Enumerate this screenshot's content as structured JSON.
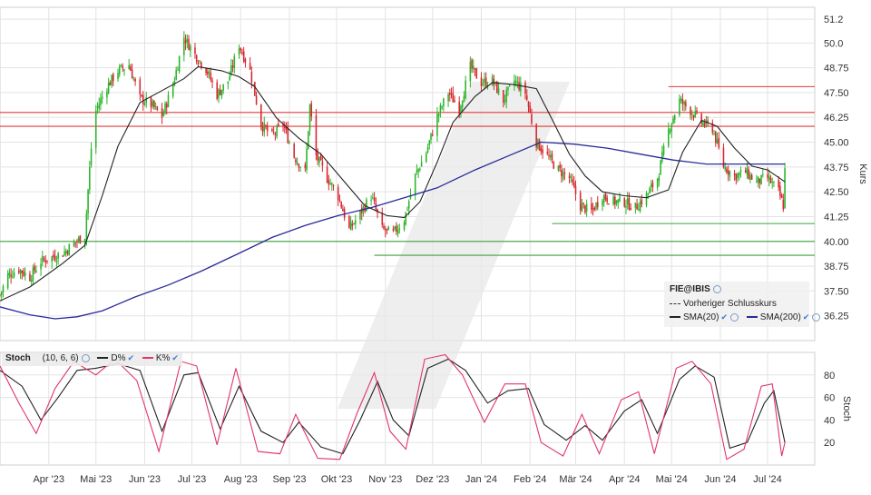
{
  "chart_data": [
    {
      "type": "candlestick",
      "symbol": "FIE@IBIS",
      "ylabel": "Kurs",
      "ylim": [
        35.0,
        51.8
      ],
      "y_ticks": [
        "51.2",
        "50.0",
        "48.75",
        "47.50",
        "46.25",
        "45.00",
        "43.75",
        "42.50",
        "41.25",
        "40.00",
        "38.75",
        "37.50",
        "36.25"
      ],
      "x_ticks": [
        "Apr '23",
        "Mai '23",
        "Jun '23",
        "Jul '23",
        "Aug '23",
        "Sep '23",
        "Okt '23",
        "Nov '23",
        "Dez '23",
        "Jan '24",
        "Feb '24",
        "Mär '24",
        "Apr '24",
        "Mai '24",
        "Jun '24",
        "Jul '24"
      ],
      "x_tick_dates": [
        "2023-04-01",
        "2023-05-01",
        "2023-06-01",
        "2023-07-01",
        "2023-08-01",
        "2023-09-01",
        "2023-10-01",
        "2023-11-01",
        "2023-12-01",
        "2024-01-01",
        "2024-02-01",
        "2024-03-01",
        "2024-04-01",
        "2024-05-01",
        "2024-06-01",
        "2024-07-01"
      ],
      "price_path": [
        [
          "2023-03-01",
          37.3
        ],
        [
          "2023-03-06",
          38.3
        ],
        [
          "2023-03-13",
          38.6
        ],
        [
          "2023-03-20",
          38.2
        ],
        [
          "2023-03-27",
          39.0
        ],
        [
          "2023-04-03",
          39.2
        ],
        [
          "2023-04-10",
          39.4
        ],
        [
          "2023-04-17",
          39.9
        ],
        [
          "2023-04-24",
          40.3
        ],
        [
          "2023-04-26",
          42.6
        ],
        [
          "2023-04-28",
          44.7
        ],
        [
          "2023-05-01",
          46.6
        ],
        [
          "2023-05-08",
          47.8
        ],
        [
          "2023-05-15",
          48.6
        ],
        [
          "2023-05-22",
          48.9
        ],
        [
          "2023-05-29",
          47.2
        ],
        [
          "2023-06-05",
          46.9
        ],
        [
          "2023-06-12",
          46.3
        ],
        [
          "2023-06-19",
          47.9
        ],
        [
          "2023-06-26",
          50.3
        ],
        [
          "2023-07-03",
          49.4
        ],
        [
          "2023-07-10",
          48.7
        ],
        [
          "2023-07-17",
          47.4
        ],
        [
          "2023-07-24",
          48.1
        ],
        [
          "2023-07-31",
          49.9
        ],
        [
          "2023-08-07",
          48.6
        ],
        [
          "2023-08-14",
          45.9
        ],
        [
          "2023-08-21",
          45.3
        ],
        [
          "2023-08-28",
          45.9
        ],
        [
          "2023-09-04",
          44.3
        ],
        [
          "2023-09-11",
          43.5
        ],
        [
          "2023-09-14",
          46.8
        ],
        [
          "2023-09-18",
          44.3
        ],
        [
          "2023-09-25",
          43.2
        ],
        [
          "2023-10-02",
          42.3
        ],
        [
          "2023-10-09",
          40.6
        ],
        [
          "2023-10-16",
          41.4
        ],
        [
          "2023-10-23",
          42.3
        ],
        [
          "2023-10-30",
          40.6
        ],
        [
          "2023-11-06",
          40.4
        ],
        [
          "2023-11-13",
          41.1
        ],
        [
          "2023-11-20",
          43.3
        ],
        [
          "2023-11-27",
          44.5
        ],
        [
          "2023-12-04",
          46.3
        ],
        [
          "2023-12-11",
          47.5
        ],
        [
          "2023-12-18",
          46.7
        ],
        [
          "2023-12-25",
          48.8
        ],
        [
          "2024-01-01",
          48.0
        ],
        [
          "2024-01-08",
          48.1
        ],
        [
          "2024-01-15",
          47.1
        ],
        [
          "2024-01-22",
          48.1
        ],
        [
          "2024-01-29",
          47.5
        ],
        [
          "2024-02-05",
          45.0
        ],
        [
          "2024-02-12",
          44.3
        ],
        [
          "2024-02-19",
          43.6
        ],
        [
          "2024-02-26",
          43.2
        ],
        [
          "2024-03-04",
          41.8
        ],
        [
          "2024-03-11",
          41.5
        ],
        [
          "2024-03-18",
          42.3
        ],
        [
          "2024-03-25",
          42.0
        ],
        [
          "2024-04-01",
          42.0
        ],
        [
          "2024-04-08",
          41.7
        ],
        [
          "2024-04-15",
          42.3
        ],
        [
          "2024-04-22",
          43.2
        ],
        [
          "2024-04-29",
          45.6
        ],
        [
          "2024-05-06",
          47.1
        ],
        [
          "2024-05-13",
          46.6
        ],
        [
          "2024-05-20",
          46.0
        ],
        [
          "2024-05-27",
          45.7
        ],
        [
          "2024-06-03",
          43.8
        ],
        [
          "2024-06-10",
          43.3
        ],
        [
          "2024-06-17",
          43.5
        ],
        [
          "2024-06-24",
          43.0
        ],
        [
          "2024-07-01",
          43.2
        ],
        [
          "2024-07-08",
          42.5
        ],
        [
          "2024-07-11",
          41.8
        ],
        [
          "2024-07-12",
          43.6
        ]
      ],
      "sma20": [
        [
          "2023-03-01",
          37.0
        ],
        [
          "2023-03-20",
          37.7
        ],
        [
          "2023-04-10",
          38.9
        ],
        [
          "2023-04-24",
          39.8
        ],
        [
          "2023-05-05",
          42.3
        ],
        [
          "2023-05-15",
          44.8
        ],
        [
          "2023-05-29",
          47.0
        ],
        [
          "2023-06-12",
          47.6
        ],
        [
          "2023-06-26",
          48.2
        ],
        [
          "2023-07-05",
          48.8
        ],
        [
          "2023-07-20",
          48.6
        ],
        [
          "2023-07-31",
          48.3
        ],
        [
          "2023-08-10",
          47.8
        ],
        [
          "2023-08-24",
          46.2
        ],
        [
          "2023-09-07",
          45.2
        ],
        [
          "2023-09-21",
          44.4
        ],
        [
          "2023-10-05",
          43.1
        ],
        [
          "2023-10-19",
          41.8
        ],
        [
          "2023-11-02",
          41.3
        ],
        [
          "2023-11-13",
          41.2
        ],
        [
          "2023-11-23",
          42.0
        ],
        [
          "2023-12-04",
          44.0
        ],
        [
          "2023-12-14",
          46.0
        ],
        [
          "2023-12-28",
          47.3
        ],
        [
          "2024-01-08",
          48.0
        ],
        [
          "2024-01-22",
          47.9
        ],
        [
          "2024-02-05",
          47.7
        ],
        [
          "2024-02-16",
          46.0
        ],
        [
          "2024-02-26",
          44.4
        ],
        [
          "2024-03-07",
          43.3
        ],
        [
          "2024-03-18",
          42.5
        ],
        [
          "2024-04-01",
          42.3
        ],
        [
          "2024-04-15",
          42.2
        ],
        [
          "2024-04-29",
          42.6
        ],
        [
          "2024-05-08",
          44.5
        ],
        [
          "2024-05-20",
          46.1
        ],
        [
          "2024-05-30",
          45.8
        ],
        [
          "2024-06-10",
          44.7
        ],
        [
          "2024-06-21",
          43.8
        ],
        [
          "2024-07-01",
          43.6
        ],
        [
          "2024-07-12",
          43.0
        ]
      ],
      "sma200": [
        [
          "2023-03-01",
          36.7
        ],
        [
          "2023-03-20",
          36.3
        ],
        [
          "2023-04-05",
          36.1
        ],
        [
          "2023-04-19",
          36.2
        ],
        [
          "2023-05-05",
          36.5
        ],
        [
          "2023-05-26",
          37.2
        ],
        [
          "2023-06-16",
          37.8
        ],
        [
          "2023-07-07",
          38.5
        ],
        [
          "2023-07-31",
          39.4
        ],
        [
          "2023-08-21",
          40.2
        ],
        [
          "2023-09-11",
          40.8
        ],
        [
          "2023-10-02",
          41.3
        ],
        [
          "2023-10-23",
          41.7
        ],
        [
          "2023-11-13",
          42.2
        ],
        [
          "2023-12-04",
          42.7
        ],
        [
          "2023-12-28",
          43.6
        ],
        [
          "2024-01-18",
          44.3
        ],
        [
          "2024-02-08",
          45.0
        ],
        [
          "2024-02-29",
          44.9
        ],
        [
          "2024-03-21",
          44.7
        ],
        [
          "2024-04-11",
          44.4
        ],
        [
          "2024-05-02",
          44.1
        ],
        [
          "2024-05-23",
          43.9
        ],
        [
          "2024-06-13",
          43.9
        ],
        [
          "2024-07-12",
          43.9
        ]
      ],
      "horizontal_lines": [
        {
          "kind": "resistance",
          "value": 47.8,
          "from": "2024-04-29",
          "to": "2024-07-31",
          "color": "#e03c3c"
        },
        {
          "kind": "resistance",
          "value": 46.5,
          "from": "2023-03-01",
          "to": "2024-07-31",
          "color": "#e03c3c"
        },
        {
          "kind": "resistance",
          "value": 45.8,
          "from": "2023-03-01",
          "to": "2024-07-31",
          "color": "#e03c3c"
        },
        {
          "kind": "support",
          "value": 40.9,
          "from": "2024-02-15",
          "to": "2024-07-31",
          "color": "#3aa33a"
        },
        {
          "kind": "support",
          "value": 40.0,
          "from": "2023-03-01",
          "to": "2024-07-31",
          "color": "#3aa33a"
        },
        {
          "kind": "support",
          "value": 39.3,
          "from": "2023-10-25",
          "to": "2024-07-31",
          "color": "#3aa33a"
        }
      ],
      "colors": {
        "up": "#2ab52a",
        "down": "#d8262e",
        "sma20": "#222222",
        "sma200": "#2a2a9a",
        "grid": "#e3e3e3"
      },
      "legend": {
        "title": "FIE@IBIS",
        "entries": [
          "Vorheriger Schlusskurs",
          "SMA(20)",
          "SMA(200)"
        ]
      },
      "grid": true,
      "legend_placement": "bottom-right"
    },
    {
      "type": "line",
      "name": "Stoch",
      "params": "(10, 6, 6)",
      "ylabel": "Stoch",
      "ylim": [
        0,
        100
      ],
      "y_ticks": [
        "80",
        "60",
        "40",
        "20"
      ],
      "series": [
        {
          "name": "D%",
          "color": "#222222",
          "points": [
            [
              "2023-03-01",
              84
            ],
            [
              "2023-03-15",
              70
            ],
            [
              "2023-03-27",
              40
            ],
            [
              "2023-04-07",
              60
            ],
            [
              "2023-04-19",
              84
            ],
            [
              "2023-05-01",
              86
            ],
            [
              "2023-05-15",
              90
            ],
            [
              "2023-05-29",
              84
            ],
            [
              "2023-06-12",
              30
            ],
            [
              "2023-06-26",
              80
            ],
            [
              "2023-07-05",
              82
            ],
            [
              "2023-07-19",
              32
            ],
            [
              "2023-07-31",
              70
            ],
            [
              "2023-08-14",
              30
            ],
            [
              "2023-08-28",
              20
            ],
            [
              "2023-09-07",
              38
            ],
            [
              "2023-09-21",
              16
            ],
            [
              "2023-10-05",
              10
            ],
            [
              "2023-10-16",
              40
            ],
            [
              "2023-10-27",
              74
            ],
            [
              "2023-11-06",
              40
            ],
            [
              "2023-11-16",
              26
            ],
            [
              "2023-11-28",
              86
            ],
            [
              "2023-12-11",
              94
            ],
            [
              "2023-12-22",
              84
            ],
            [
              "2024-01-05",
              55
            ],
            [
              "2024-01-18",
              66
            ],
            [
              "2024-01-31",
              68
            ],
            [
              "2024-02-10",
              36
            ],
            [
              "2024-02-24",
              22
            ],
            [
              "2024-03-07",
              35
            ],
            [
              "2024-03-18",
              22
            ],
            [
              "2024-04-01",
              48
            ],
            [
              "2024-04-12",
              58
            ],
            [
              "2024-04-22",
              28
            ],
            [
              "2024-05-06",
              76
            ],
            [
              "2024-05-16",
              88
            ],
            [
              "2024-05-28",
              78
            ],
            [
              "2024-06-07",
              15
            ],
            [
              "2024-06-18",
              20
            ],
            [
              "2024-06-29",
              55
            ],
            [
              "2024-07-05",
              66
            ],
            [
              "2024-07-12",
              20
            ]
          ]
        },
        {
          "name": "K%",
          "color": "#e0356a",
          "points": [
            [
              "2023-03-01",
              88
            ],
            [
              "2023-03-13",
              55
            ],
            [
              "2023-03-24",
              28
            ],
            [
              "2023-04-05",
              68
            ],
            [
              "2023-04-17",
              92
            ],
            [
              "2023-05-01",
              80
            ],
            [
              "2023-05-13",
              94
            ],
            [
              "2023-05-27",
              75
            ],
            [
              "2023-06-10",
              12
            ],
            [
              "2023-06-24",
              92
            ],
            [
              "2023-07-04",
              88
            ],
            [
              "2023-07-17",
              18
            ],
            [
              "2023-07-29",
              86
            ],
            [
              "2023-08-12",
              12
            ],
            [
              "2023-08-26",
              10
            ],
            [
              "2023-09-05",
              45
            ],
            [
              "2023-09-19",
              6
            ],
            [
              "2023-10-03",
              5
            ],
            [
              "2023-10-14",
              46
            ],
            [
              "2023-10-25",
              82
            ],
            [
              "2023-11-04",
              30
            ],
            [
              "2023-11-14",
              14
            ],
            [
              "2023-11-26",
              94
            ],
            [
              "2023-12-09",
              98
            ],
            [
              "2023-12-20",
              80
            ],
            [
              "2024-01-03",
              38
            ],
            [
              "2024-01-16",
              72
            ],
            [
              "2024-01-29",
              72
            ],
            [
              "2024-02-08",
              20
            ],
            [
              "2024-02-22",
              8
            ],
            [
              "2024-03-05",
              45
            ],
            [
              "2024-03-16",
              10
            ],
            [
              "2024-03-30",
              58
            ],
            [
              "2024-04-10",
              65
            ],
            [
              "2024-04-20",
              10
            ],
            [
              "2024-05-04",
              86
            ],
            [
              "2024-05-14",
              92
            ],
            [
              "2024-05-26",
              72
            ],
            [
              "2024-06-05",
              5
            ],
            [
              "2024-06-16",
              14
            ],
            [
              "2024-06-27",
              70
            ],
            [
              "2024-07-04",
              72
            ],
            [
              "2024-07-10",
              8
            ],
            [
              "2024-07-12",
              20
            ]
          ]
        }
      ],
      "grid": true
    }
  ],
  "stoch_legend": {
    "label": "Stoch",
    "params": "(10, 6, 6)",
    "d": "D%",
    "k": "K%"
  }
}
